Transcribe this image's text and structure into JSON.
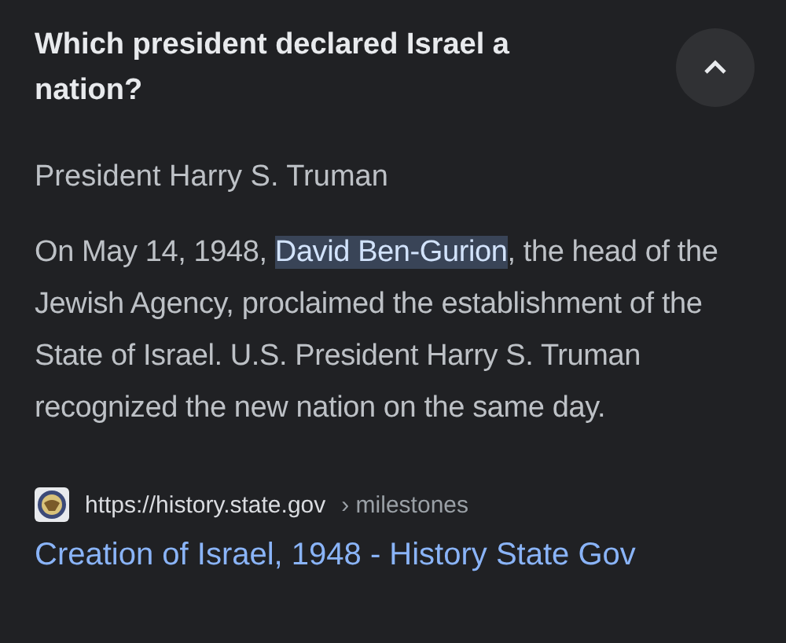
{
  "question": "Which president declared Israel a nation?",
  "collapse_button": {
    "expanded": true
  },
  "answer": "President Harry S. Truman",
  "paragraph": {
    "text_before": "On May 14, 1948, ",
    "highlighted": "David Ben-Gurion",
    "text_after": ", the head of the Jewish Agency, proclaimed the establishment of the State of Israel. U.S. President Harry S. Truman recognized the new nation on the same day."
  },
  "source": {
    "url": "https://history.state.gov",
    "breadcrumb": "› milestones",
    "title": "Creation of Israel, 1948 - History State Gov"
  }
}
